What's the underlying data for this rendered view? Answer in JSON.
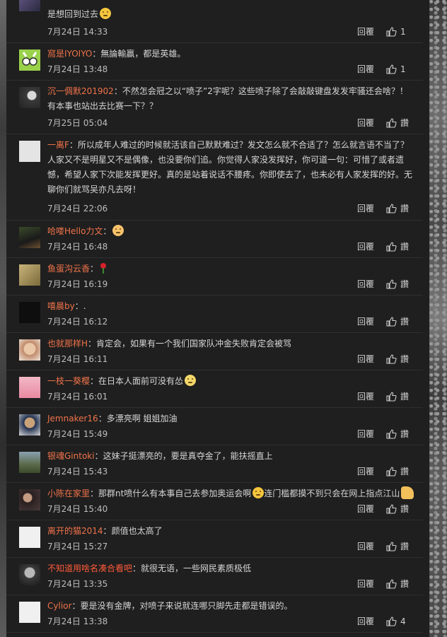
{
  "reply_label": "回覆",
  "like_label": "讚",
  "comments": [
    {
      "user": "",
      "text": "是想回到过去",
      "emoji": "sleepy",
      "time": "7月24日 14:33",
      "likes": "1"
    },
    {
      "user": "窩是IYOIYO",
      "text": "無論輸贏，都是英雄。",
      "time": "7月24日 13:48",
      "likes": "1"
    },
    {
      "user": "沉一倜默201902",
      "text": "不然怎会冠之以“喷子”2字呢？这些喷子除了会敲敲键盘发发牢骚还会啥？！有本事也站出去比赛一下？？",
      "time": "7月25日 05:04",
      "likes": ""
    },
    {
      "user": "一离F",
      "text": "所以成年人难过的时候就活该自己默默难过？发文怎么就不合适了？怎么就言语不当了？人家又不是明星又不是偶像，也没要你们追。你觉得人家没发挥好，你可道一句：可惜了或者遗憾，希望人家下次能发挥更好。真的是站着说话不腰疼。你即使去了，也未必有人家发挥的好。无聊你们就骂吴亦凡去呀！",
      "time": "7月24日 22:06",
      "likes": ""
    },
    {
      "user": "哈喽Hello力文",
      "text": "",
      "emoji": "pray",
      "time": "7月24日 16:48",
      "likes": ""
    },
    {
      "user": "鱼蛋沟云香",
      "text": "",
      "emoji": "rose",
      "time": "7月24日 16:19",
      "likes": ""
    },
    {
      "user": "嘻晨by",
      "text": ".",
      "time": "7月24日 16:12",
      "likes": ""
    },
    {
      "user": "也就那样H",
      "text": "肯定会，如果有一个我们国家队冲金失败肯定会被骂",
      "time": "7月24日 16:11",
      "likes": ""
    },
    {
      "user": "一枝一葵樱",
      "text": "在日本人面前可没有怂",
      "emoji": "face",
      "time": "7月24日 16:01",
      "likes": ""
    },
    {
      "user": "Jemnaker16",
      "text": "多漂亮啊 姐姐加油",
      "time": "7月24日 15:49",
      "likes": ""
    },
    {
      "user": "银魂Gintoki",
      "text": "这妹子挺漂亮的，要是真夺金了，能扶摇直上",
      "time": "7月24日 15:43",
      "likes": ""
    },
    {
      "user": "小陈在家里",
      "text": "那群nt喷什么有本事自己去参加奥运会啊",
      "emoji": "sweat",
      "text2": "连门槛都摸不到只会在网上指点江山",
      "emoji2": "thumb",
      "time": "7月24日 15:40",
      "likes": ""
    },
    {
      "user": "离开的猫2014",
      "text": "颜值也太高了",
      "time": "7月24日 15:27",
      "likes": ""
    },
    {
      "user": "不知道用啥名凑合看吧",
      "text": "就很无语，一些网民素质极低",
      "time": "7月24日 13:35",
      "likes": ""
    },
    {
      "user": "Cylior",
      "text": "要是没有金牌，对喷子来说就连哪只脚先走都是错误的。",
      "time": "7月24日 13:38",
      "likes": "4"
    }
  ]
}
